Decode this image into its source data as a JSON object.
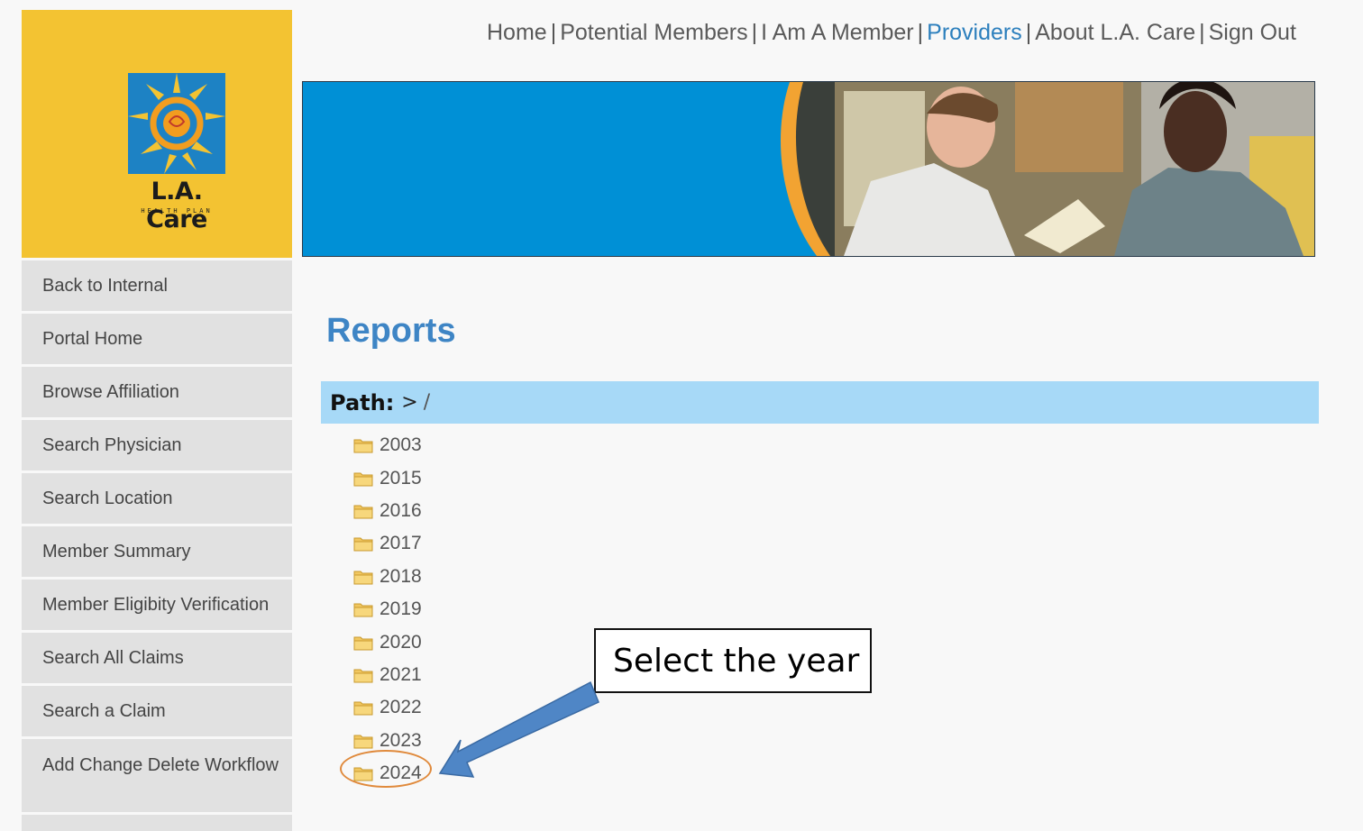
{
  "logo": {
    "name": "L.A. Care",
    "tagline": "HEALTH PLAN",
    "colors": {
      "background": "#f3c332",
      "square": "#1d82c4",
      "sun": "#f29d1f"
    }
  },
  "top_nav": {
    "items": [
      {
        "label": "Home",
        "active": false
      },
      {
        "label": "Potential Members",
        "active": false
      },
      {
        "label": "I Am A Member",
        "active": false
      },
      {
        "label": "Providers",
        "active": true
      },
      {
        "label": "About L.A. Care",
        "active": false
      },
      {
        "label": "Sign Out",
        "active": false
      }
    ],
    "separator": "|"
  },
  "sidebar": {
    "items": [
      {
        "label": "Back to Internal"
      },
      {
        "label": "Portal Home"
      },
      {
        "label": "Browse Affiliation"
      },
      {
        "label": "Search Physician"
      },
      {
        "label": "Search Location"
      },
      {
        "label": "Member Summary"
      },
      {
        "label": "Member Eligibity Verification"
      },
      {
        "label": "Search All Claims"
      },
      {
        "label": "Search a Claim"
      },
      {
        "label": "Add Change Delete Workflow"
      }
    ]
  },
  "main": {
    "title": "Reports",
    "path_label": "Path:",
    "path_value": ">",
    "path_root": "/",
    "folders": [
      "2003",
      "2015",
      "2016",
      "2017",
      "2018",
      "2019",
      "2020",
      "2021",
      "2022",
      "2023",
      "2024"
    ],
    "highlighted_folder": "2024"
  },
  "annotation": {
    "callout_text": "Select the year",
    "colors": {
      "arrow": "#4f86c6",
      "circle": "#e08a3c"
    }
  }
}
